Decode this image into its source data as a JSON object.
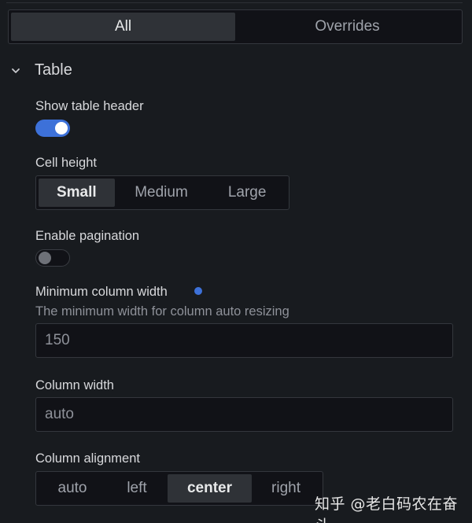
{
  "tabs": [
    {
      "label": "All",
      "active": true
    },
    {
      "label": "Overrides",
      "active": false
    }
  ],
  "section": {
    "title": "Table",
    "expanded": true
  },
  "show_header": {
    "label": "Show table header",
    "value": true
  },
  "cell_height": {
    "label": "Cell height",
    "options": [
      "Small",
      "Medium",
      "Large"
    ],
    "selected": "Small"
  },
  "pagination": {
    "label": "Enable pagination",
    "value": false
  },
  "min_col_width": {
    "label": "Minimum column width",
    "description": "The minimum width for column auto resizing",
    "value": "150",
    "modified_indicator_color": "#3d71d9"
  },
  "col_width": {
    "label": "Column width",
    "placeholder": "auto"
  },
  "col_alignment": {
    "label": "Column alignment",
    "options": [
      "auto",
      "left",
      "center",
      "right"
    ],
    "selected": "center"
  },
  "watermark": "知乎 @老白码农在奋斗",
  "colors": {
    "accent": "#3d71d9",
    "background": "#181b1f"
  }
}
